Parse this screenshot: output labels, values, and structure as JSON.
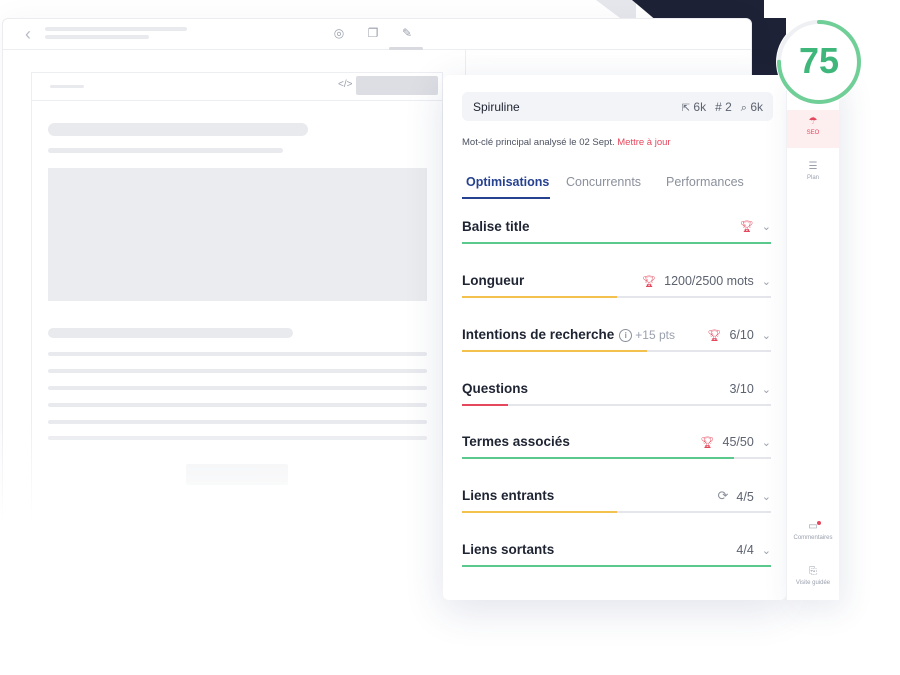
{
  "score": {
    "value": "75",
    "fraction": 0.75,
    "color": "#6fcf97"
  },
  "keyword": {
    "text": "Spiruline",
    "stat1": "6k",
    "stat2": "2",
    "stat3": "6k",
    "stat1_icon": "cursor-icon",
    "stat2_icon": "hash-icon",
    "stat3_icon": "search-icon"
  },
  "meta": {
    "text": "Mot-clé principal analysé le 02 Sept.",
    "link": "Mettre à jour"
  },
  "tabs": [
    "Optimisations",
    "Concurrennts",
    "Performances"
  ],
  "rows": [
    {
      "label": "Balise title",
      "value": "",
      "fill": 1.0,
      "color": "#5cc98c",
      "icon": "trophy-icon"
    },
    {
      "label": "Longueur",
      "value": "1200/2500 mots",
      "fill": 0.5,
      "color": "#f2c14e",
      "icon": "trophy-icon"
    },
    {
      "label": "Intentions de recherche",
      "extra": "+15 pts",
      "value": "6/10",
      "fill": 0.6,
      "color": "#f2c14e",
      "icon": "trophy-icon"
    },
    {
      "label": "Questions",
      "value": "3/10",
      "fill": 0.15,
      "color": "#e5475d",
      "icon": ""
    },
    {
      "label": "Termes associés",
      "value": "45/50",
      "fill": 0.88,
      "color": "#5cc98c",
      "icon": "trophy-icon"
    },
    {
      "label": "Liens entrants",
      "value": "4/5",
      "fill": 0.5,
      "color": "#f2c14e",
      "icon": "sync-icon"
    },
    {
      "label": "Liens sortants",
      "value": "4/4",
      "fill": 1.0,
      "color": "#5cc98c",
      "icon": ""
    }
  ],
  "rail": {
    "seo": "SEO",
    "plan": "Plan",
    "comments": "Commentaires",
    "tour": "Visite guidée"
  },
  "colors": {
    "accent": "#26418f",
    "danger": "#e5475d",
    "good": "#5cc98c",
    "warn": "#f2c14e"
  }
}
